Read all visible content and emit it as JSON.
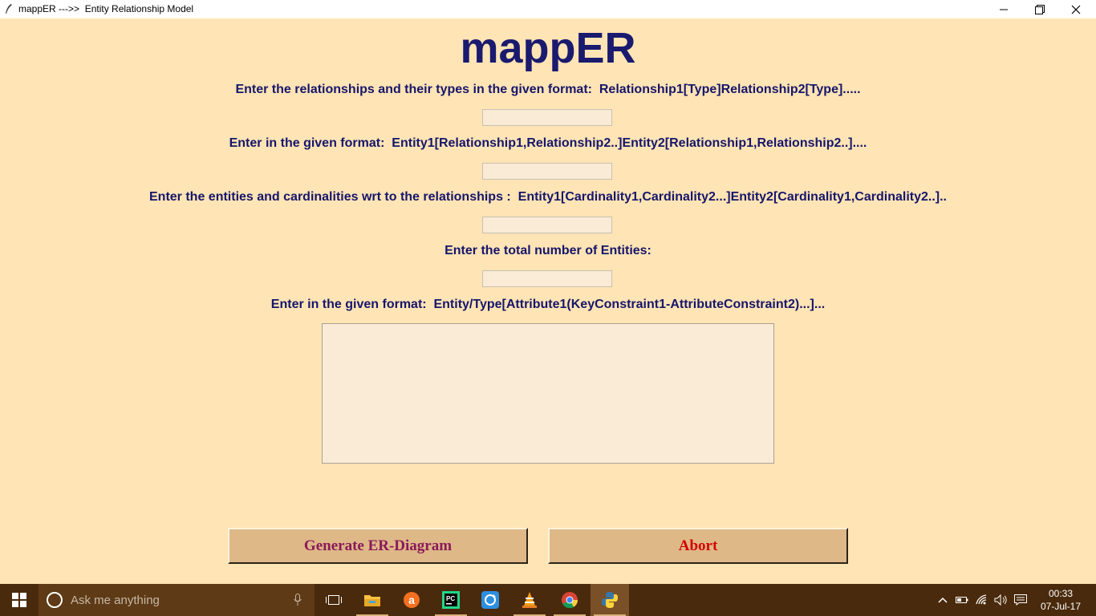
{
  "window": {
    "title": "mappER --->>  Entity Relationship Model",
    "controls": {
      "minimize_icon": "minimize-icon",
      "maximize_icon": "restore-icon",
      "close_icon": "close-icon"
    }
  },
  "app": {
    "title": "mappER",
    "labels": {
      "relationships": "Enter the relationships and their types in the given format:  Relationship1[Type]Relationship2[Type].....",
      "entities_relationships": "Enter in the given format:  Entity1[Relationship1,Relationship2..]Entity2[Relationship1,Relationship2..]....",
      "cardinalities": "Enter the entities and cardinalities wrt to the relationships :  Entity1[Cardinality1,Cardinality2...]Entity2[Cardinality1,Cardinality2..]..",
      "total_entities": "Enter the total number of Entities:",
      "attributes": "Enter in the given format:  Entity/Type[Attribute1(KeyConstraint1-AttributeConstraint2)...]..."
    },
    "inputs": {
      "relationships_value": "",
      "entities_relationships_value": "",
      "cardinalities_value": "",
      "total_entities_value": "",
      "attributes_value": ""
    },
    "buttons": {
      "generate": "Generate ER-Diagram",
      "abort": "Abort"
    },
    "colors": {
      "background": "#ffe4b5",
      "entry_bg": "#faebd7",
      "button_bg": "#deb887",
      "label_text": "#16166b",
      "generate_text": "#8b1a5a",
      "abort_text": "#d40000"
    }
  },
  "taskbar": {
    "search_placeholder": "Ask me anything",
    "pinned": [
      "task-view-icon",
      "file-explorer-icon",
      "avast-icon",
      "pycharm-icon",
      "sync-icon",
      "vlc-icon",
      "chrome-icon",
      "python-icon"
    ],
    "tray_icons": [
      "chevron-up-icon",
      "battery-icon",
      "wifi-icon",
      "volume-icon",
      "notification-icon"
    ],
    "clock": {
      "time": "00:33",
      "date": "07-Jul-17"
    }
  }
}
